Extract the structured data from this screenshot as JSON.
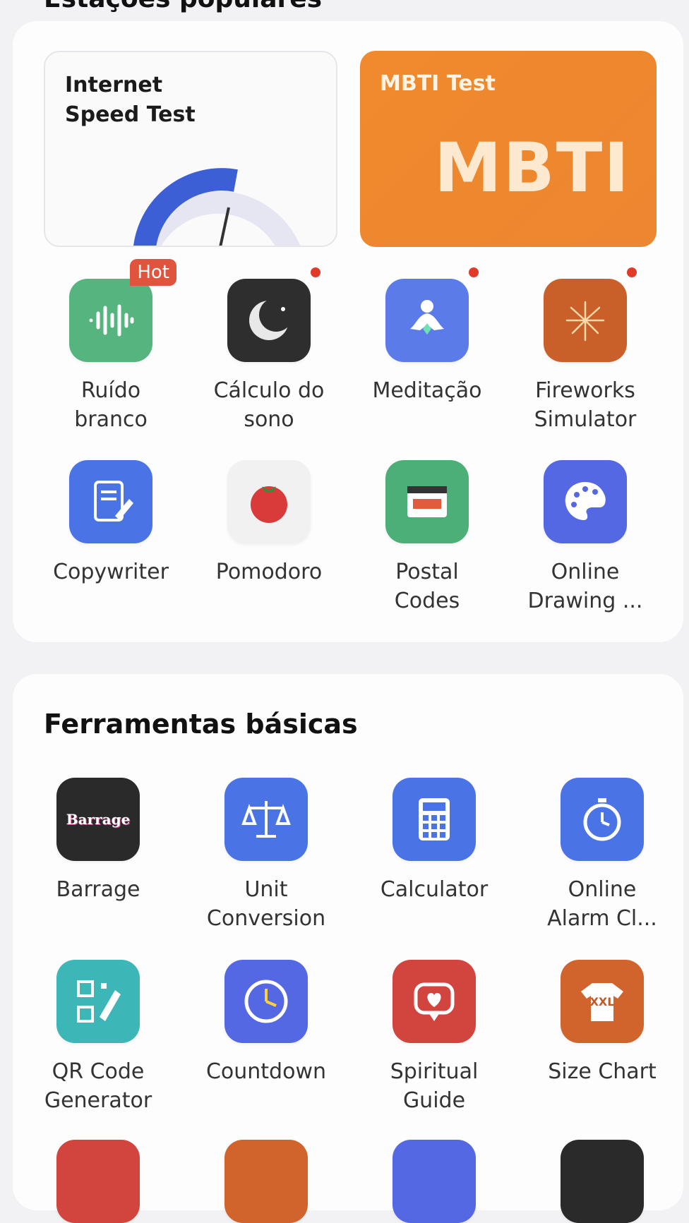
{
  "popular": {
    "title": "Estações populares",
    "banners": {
      "speed_test": "Internet\nSpeed Test",
      "mbti": {
        "title": "MBTI Test",
        "big_text": "MBTI"
      }
    },
    "items": [
      {
        "label": "Ruído\nbranco",
        "badge": "Hot",
        "icon": "white-noise-icon",
        "color": "#56b47f"
      },
      {
        "label": "Cálculo do\nsono",
        "icon": "moon-icon",
        "color": "#2e2e2e"
      },
      {
        "label": "Meditação",
        "icon": "meditation-icon",
        "color": "#5b7be8"
      },
      {
        "label": "Fireworks\nSimulator",
        "icon": "fireworks-icon",
        "color": "#c9602a"
      },
      {
        "label": "Copywriter",
        "icon": "document-pen-icon",
        "color": "#4a74e6"
      },
      {
        "label": "Pomodoro",
        "icon": "tomato-icon",
        "color": "#f1f1f1"
      },
      {
        "label": "Postal\nCodes",
        "icon": "postal-icon",
        "color": "#4caf78"
      },
      {
        "label": "Online\nDrawing ...",
        "icon": "palette-icon",
        "color": "#5468e4"
      }
    ]
  },
  "basic": {
    "title": "Ferramentas básicas",
    "items": [
      {
        "label": "Barrage",
        "icon": "barrage-icon",
        "color": "#2a2a2a",
        "icon_text": "Barrage"
      },
      {
        "label": "Unit\nConversion",
        "icon": "scale-icon",
        "color": "#4a74e6"
      },
      {
        "label": "Calculator",
        "icon": "calculator-icon",
        "color": "#4a74e6"
      },
      {
        "label": "Online\nAlarm Cl...",
        "icon": "alarm-icon",
        "color": "#4a74e6"
      },
      {
        "label": "QR Code\nGenerator",
        "icon": "qr-code-icon",
        "color": "#3cb6b6"
      },
      {
        "label": "Countdown",
        "icon": "clock-icon",
        "color": "#5468e4"
      },
      {
        "label": "Spiritual\nGuide",
        "icon": "heart-chat-icon",
        "color": "#d2453f"
      },
      {
        "label": "Size Chart",
        "icon": "tshirt-icon",
        "color": "#d0642c",
        "icon_text": "XXL"
      }
    ]
  }
}
